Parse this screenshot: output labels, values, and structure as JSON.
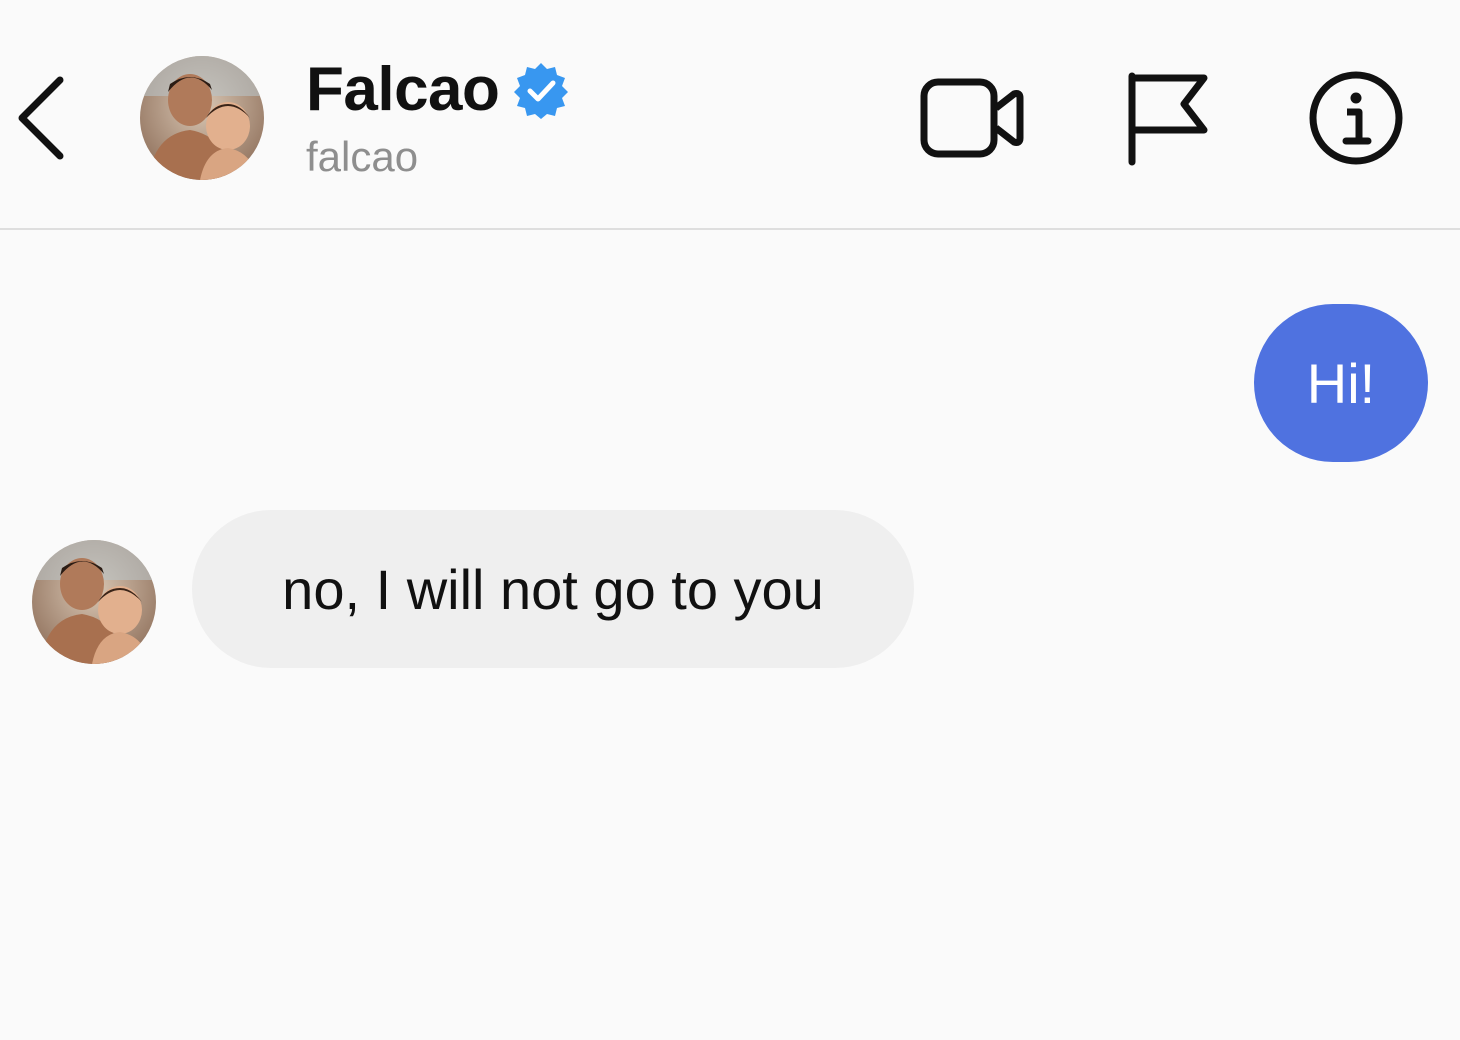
{
  "header": {
    "display_name": "Falcao",
    "username": "falcao",
    "verified_badge_icon": "verified-check-icon",
    "back_icon": "chevron-left-icon",
    "video_icon": "video-camera-icon",
    "flag_icon": "flag-icon",
    "info_icon": "info-icon"
  },
  "thread": {
    "messages": [
      {
        "direction": "outgoing",
        "text": "Hi!"
      },
      {
        "direction": "incoming",
        "text": "no, I will not go to you"
      }
    ]
  },
  "colors": {
    "outgoing_bubble": "#4f72e0",
    "incoming_bubble": "#efefef",
    "verified_badge": "#3897f0",
    "background": "#fafafa"
  }
}
